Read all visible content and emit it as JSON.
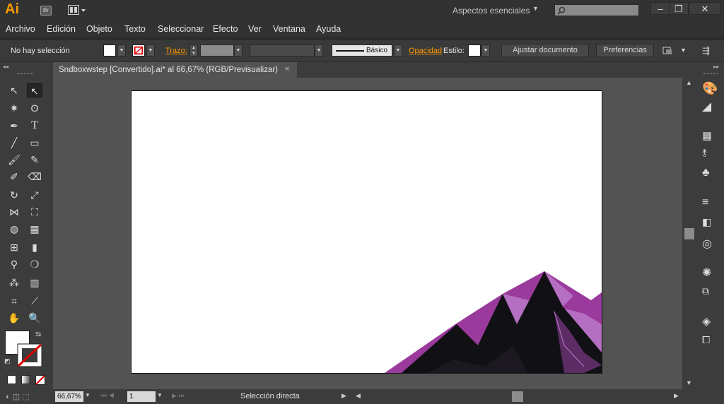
{
  "app": {
    "logo": "Ai",
    "bridge": "Br"
  },
  "workspace": {
    "label": "Aspectos esenciales"
  },
  "menu": [
    "Archivo",
    "Edición",
    "Objeto",
    "Texto",
    "Seleccionar",
    "Efecto",
    "Ver",
    "Ventana",
    "Ayuda"
  ],
  "control": {
    "selection": "No hay selección",
    "stroke_label": "Trazo:",
    "stroke_style": "Básico",
    "opacity_label": "Opacidad",
    "style_label": "Estilo:",
    "align_doc_button": "Ajustar documento",
    "prefs_button": "Preferencias"
  },
  "document": {
    "tab_title": "Sndboxwstep [Convertido].ai* al 66,67% (RGB/Previsualizar)",
    "close": "×"
  },
  "status": {
    "zoom": "66,67%",
    "artboard_num": "1",
    "tool_name": "Selección directa"
  },
  "colors": {
    "accent": "#ff9a00",
    "mountain_dark": "#111014",
    "mountain_purple": "#9b3a9d",
    "mountain_light": "#b56fc2"
  }
}
